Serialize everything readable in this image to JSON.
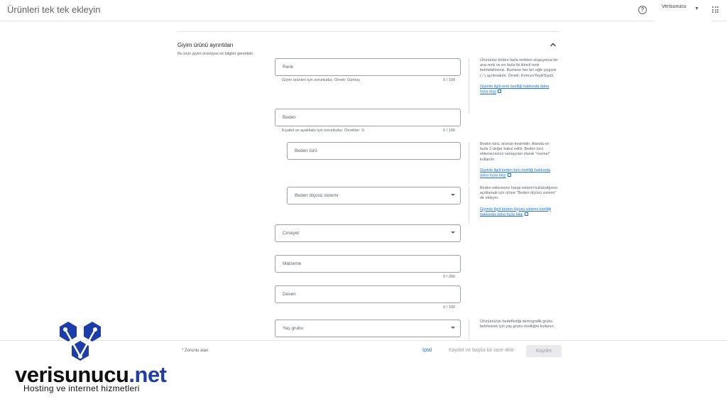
{
  "header": {
    "title": "Ürünleri tek tek ekleyin",
    "help_icon": "help-circle-icon",
    "account_name": "Verisunucu",
    "apps_icon": "apps-grid-icon"
  },
  "section": {
    "title": "Giyim ürünü ayrıntıları",
    "subtitle": "Bu ürün giyim ürünüyse ek bilgiler gereklidir",
    "collapse_icon": "chevron-up-icon"
  },
  "fields": {
    "color": {
      "label": "Renk",
      "hint": "Giyim ürünleri için zorunludur. Örnek: Gümüş",
      "counter": "0 / 100"
    },
    "size": {
      "label": "Beden",
      "hint": "Kıyafet ve ayakkabı için zorunludur. Örnekler: S",
      "counter": "0 / 100"
    },
    "size_type": {
      "label": "Beden türü"
    },
    "size_system": {
      "label": "Beden ölçüsü sistemi"
    },
    "gender": {
      "label": "Cinsiyet"
    },
    "material": {
      "label": "Malzeme",
      "counter": "0 / 200"
    },
    "pattern": {
      "label": "Desen",
      "counter": "0 / 100"
    },
    "age_group": {
      "label": "Yaş grubu"
    }
  },
  "help": {
    "color_text": "Ürününüz birden fazla renkten oluşuyorsa bir ana renk ve en fazla iki ikincil renk belirtebilirsiniz. Bunların her biri eğik çizgiyle ( / ) ayrılmalıdır. Örnek: Kırmızı/Yeşil/Siyah.",
    "color_link": "Giyimle ilgili renk özelliği hakkında daha fazla bilgi",
    "size_type_text": "Beden türü, ürünün kesimidir. Alanda en fazla 2 değer kabul edilir. Beden türü eklemezseniz varsayılan olarak \"normal\" kullanılır.",
    "size_type_link": "Giyimle ilgili beden türü özelliği hakkında daha fazla bilgi",
    "size_system_text": "Beden eklerseniz hangi sistemi kullandığınızı açıklamak için ürüne \"Beden ölçüsü sistemi\" de ekleyin.",
    "size_system_link": "Giyimle ilgili beden ölçüsü sistemi özelliği hakkında daha fazla bilgi",
    "age_group_text": "Ürününüzün hedeflediği demografik grubu belirlemek için yaş grubu özelliğini kullanın.",
    "external_icon": "open-in-new-icon"
  },
  "footer": {
    "required_note": "* Zorunlu alan",
    "cancel": "İptal",
    "save_and_add": "Kaydet ve başka bir tane ekle",
    "save": "Kaydet"
  },
  "watermark": {
    "brand": "verisunucu",
    "tld": ".net",
    "tagline": "Hosting ve internet hizmetleri",
    "icon": "verisunucu-logo-icon",
    "brand_color": "#1d3ea8"
  }
}
